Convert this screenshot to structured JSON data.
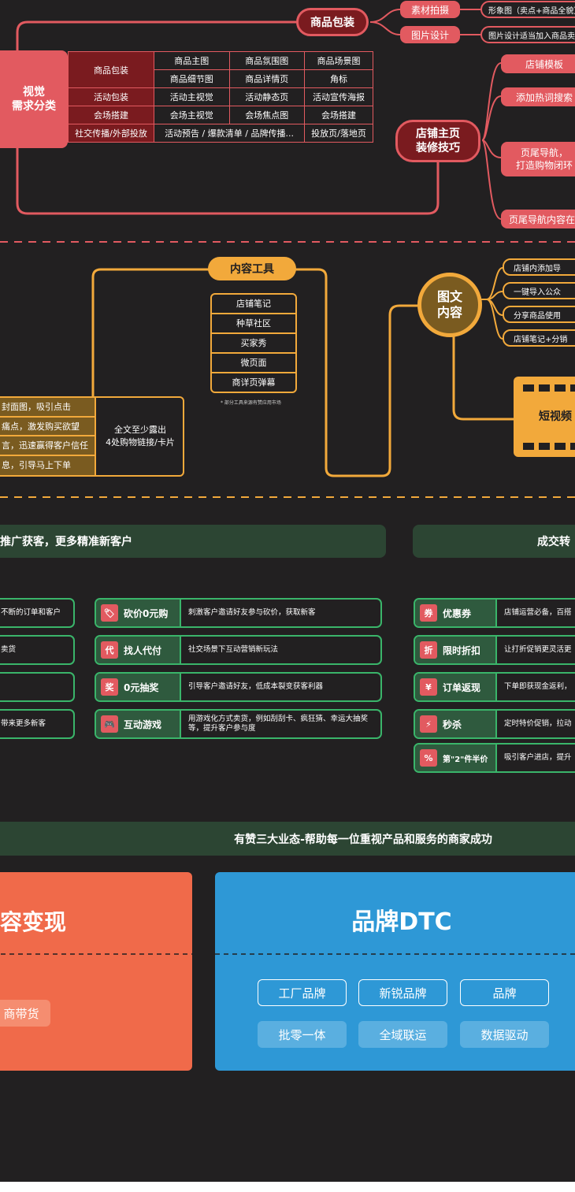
{
  "visual": {
    "side_label": "视觉\n需求分类",
    "pkg_node": "商品包装",
    "pkg_children": [
      "素材拍摄",
      "图片设计"
    ],
    "pkg_notes": [
      "形象图（卖点+商品全貌）",
      "图片设计适当加入商品卖点"
    ],
    "table": [
      {
        "label": "商品包装",
        "cells": [
          "商品主图",
          "商品氛围图",
          "商品场景图",
          "商品细节图",
          "商品详情页",
          "角标"
        ]
      },
      {
        "label": "活动包装",
        "cells": [
          "活动主视觉",
          "活动静态页",
          "活动宣传海报"
        ]
      },
      {
        "label": "会场搭建",
        "cells": [
          "会场主视觉",
          "会场焦点图",
          "会场搭建"
        ]
      },
      {
        "label": "社交传播/外部投放",
        "cells": [
          "活动预告 / 爆款清单 / 品牌传播...",
          "投放页/落地页"
        ]
      }
    ],
    "shop_node": "店铺主页\n装修技巧",
    "shop_items": [
      "店铺模板",
      "添加热词搜索",
      "页尾导航，\n打造购物闭环",
      "页尾导航内容在精"
    ]
  },
  "content": {
    "tools_title": "内容工具",
    "tools": [
      "店铺笔记",
      "种草社区",
      "买家秀",
      "微页面",
      "商详页弹幕"
    ],
    "tools_note": "* 部分工具来源有赞应用市场",
    "left_items": [
      "封面图，吸引点击",
      "痛点，激发购买欲望",
      "言，迅速赢得客户信任",
      "息，引导马上下单"
    ],
    "left_summary": "全文至少露出\n4处购物链接/卡片",
    "tuwen": "图文\n内容",
    "tuwen_items": [
      "店铺内添加导",
      "一键导入公众",
      "分享商品使用",
      "店铺笔记+分销"
    ],
    "video": "短视频"
  },
  "growth": {
    "band_left": "推广获客，更多精准新客户",
    "band_right": "成交转",
    "left_partial": [
      "不断的订单和客户",
      "卖货",
      "",
      "带来更多新客"
    ],
    "middle": [
      {
        "icon": "🏷",
        "title": "砍价0元购",
        "desc": "刺激客户邀请好友参与砍价，获取新客"
      },
      {
        "icon": "代",
        "title": "找人代付",
        "desc": "社交场景下互动营销新玩法"
      },
      {
        "icon": "奖",
        "title": "0元抽奖",
        "desc": "引导客户邀请好友，低成本裂变获客利器"
      },
      {
        "icon": "🎮",
        "title": "互动游戏",
        "desc": "用游戏化方式卖货，例如刮刮卡、疯狂猜、幸运大抽奖\n等，提升客户参与度"
      }
    ],
    "right": [
      {
        "icon": "券",
        "title": "优惠券",
        "desc": "店铺运营必备，百搭"
      },
      {
        "icon": "折",
        "title": "限时折扣",
        "desc": "让打折促销更灵活更"
      },
      {
        "icon": "¥",
        "title": "订单返现",
        "desc": "下单即获现金返利，"
      },
      {
        "icon": "⚡",
        "title": "秒杀",
        "desc": "定时特价促销，拉动"
      },
      {
        "icon": "%",
        "title": "第\"2\"件半价",
        "desc": "吸引客户进店，提升"
      }
    ]
  },
  "business": {
    "banner": "有赞三大业态-帮助每一位重视产品和服务的商家成功",
    "left_title": "容变现",
    "left_tag": "商带货",
    "dtc_title": "品牌DTC",
    "dtc_tags_row1": [
      "工厂品牌",
      "新锐品牌",
      "品牌"
    ],
    "dtc_tags_row2": [
      "批零一体",
      "全域联运",
      "数据驱动"
    ]
  },
  "colors": {
    "background": "#222021",
    "pink": "#e25a60",
    "orange": "#f2a93b",
    "green": "#3ab56a",
    "dtc_blue": "#2e98d6",
    "left_orange": "#f06a4a"
  }
}
